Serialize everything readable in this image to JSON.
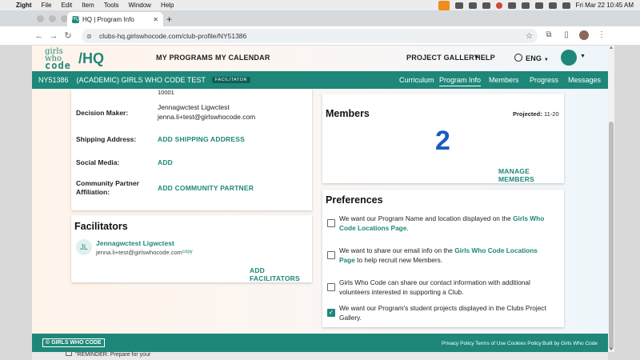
{
  "menubar": {
    "apple": "",
    "app": "Zight",
    "items": [
      "File",
      "Edit",
      "Item",
      "Tools",
      "Window",
      "Help"
    ],
    "datetime": "Fri Mar 22  10:45 AM"
  },
  "browser": {
    "tab_title": "HQ | Program Info",
    "tab_favicon": "HQ",
    "url": "clubs-hq.girlswhocode.com/club-profile/NY51386"
  },
  "header": {
    "logo_line1": "girls who",
    "logo_line2": "code",
    "logo_hq": "/HQ",
    "nav": {
      "my_programs": "MY PROGRAMS",
      "my_calendar": "MY CALENDAR",
      "project_gallery": "PROJECT GALLERY",
      "help": "HELP",
      "language": "ENG"
    }
  },
  "clubbar": {
    "club_id": "NY51386",
    "club_name": "(ACADEMIC) GIRLS WHO CODE TEST",
    "role_badge": "FACILITATOR",
    "tabs": [
      "Curriculum",
      "Program Info",
      "Members",
      "Progress",
      "Messages"
    ],
    "active_tab": "Program Info"
  },
  "info_card": {
    "partial_text": "10001",
    "decision_maker_label": "Decision Maker:",
    "decision_maker_name": "Jennagwctest Ligwctest",
    "decision_maker_email": "jenna.li+test@girlswhocode.com",
    "shipping_label": "Shipping Address:",
    "shipping_action": "ADD SHIPPING ADDRESS",
    "social_label": "Social Media:",
    "social_action": "ADD",
    "partner_label_1": "Community Partner",
    "partner_label_2": "Affiliation:",
    "partner_action": "ADD COMMUNITY PARTNER"
  },
  "facilitators": {
    "title": "Facilitators",
    "avatar_initials": "JL",
    "name": "Jennagwctest Ligwctest",
    "email": "jenna.li+test@girlswhocode.com",
    "copy": "copy",
    "action": "ADD FACILITATORS"
  },
  "members": {
    "title": "Members",
    "projected_label": "Projected:",
    "projected_value": "11-20",
    "count": "2",
    "action": "MANAGE MEMBERS"
  },
  "preferences": {
    "title": "Preferences",
    "items": [
      {
        "pre": "We want our Program Name and location displayed on the ",
        "link": "Girls Who Code Locations Page",
        "post": ".",
        "checked": false
      },
      {
        "pre": "We want to share our email info on the ",
        "link": "Girls Who Code Locations Page",
        "post": " to help recruit new Members.",
        "checked": false
      },
      {
        "pre": "Girls Who Code can share our contact information with additional volunteers interested in supporting a Club.",
        "link": "",
        "post": "",
        "checked": true
      },
      {
        "pre": "We want our Program's student projects displayed in the Clubs Project Gallery.",
        "link": "",
        "post": "",
        "checked": true
      }
    ]
  },
  "footer": {
    "brand": "© GIRLS WHO CODE",
    "links": [
      "Privacy Policy",
      "Terms of Use",
      "Cookies Policy",
      "Built by Girls Who Code"
    ]
  },
  "notification": {
    "text": "\"REMINDER: Prepare for your"
  },
  "colors": {
    "brand": "#1e8779",
    "member_count": "#1a5bbf"
  }
}
